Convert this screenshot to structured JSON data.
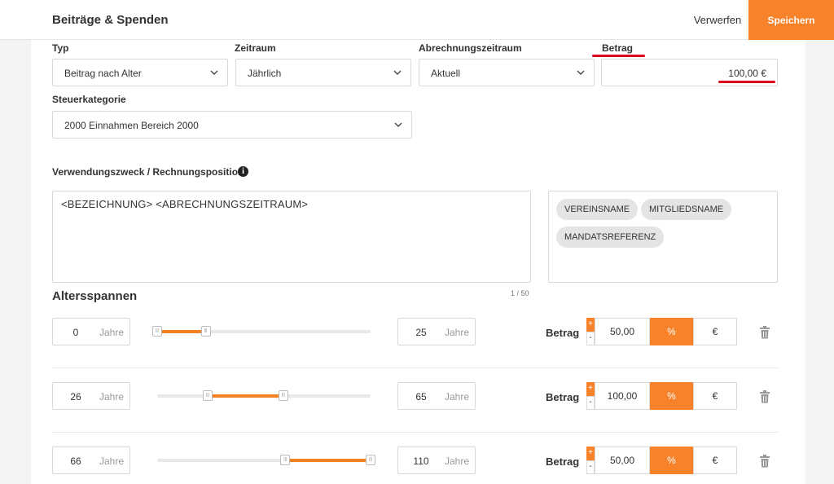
{
  "header": {
    "title": "Beiträge & Spenden",
    "discard_label": "Verwerfen",
    "save_label": "Speichern"
  },
  "fields": {
    "typ": {
      "label": "Typ",
      "value": "Beitrag nach Alter"
    },
    "zeitraum": {
      "label": "Zeitraum",
      "value": "Jährlich"
    },
    "abrechnungszeitraum": {
      "label": "Abrechnungszeitraum",
      "value": "Aktuell"
    },
    "betrag": {
      "label": "Betrag",
      "value": "100,00 €"
    },
    "steuerkategorie": {
      "label": "Steuerkategorie",
      "value": "2000 Einnahmen Bereich 2000"
    }
  },
  "verwendungszweck": {
    "label": "Verwendungszweck / Rechnungsposition",
    "text": "<BEZEICHNUNG> <ABRECHNUNGSZEITRAUM>",
    "counter": "1 / 50",
    "chips": [
      "VEREINSNAME",
      "MITGLIEDSNAME",
      "MANDATSREFERENZ"
    ]
  },
  "altersspannen": {
    "title": "Altersspannen",
    "unit_label": "Jahre",
    "betrag_label": "Betrag",
    "plus": "+",
    "minus": "-",
    "pct_label": "%",
    "eur_label": "€",
    "slider_max_age": 110,
    "rows": [
      {
        "from": "0",
        "to": "25",
        "amount": "50,00",
        "mode": "percent"
      },
      {
        "from": "26",
        "to": "65",
        "amount": "100,00",
        "mode": "percent"
      },
      {
        "from": "66",
        "to": "110",
        "amount": "50,00",
        "mode": "percent"
      }
    ]
  },
  "colors": {
    "accent": "#f7822a",
    "highlight": "#e0001b"
  }
}
